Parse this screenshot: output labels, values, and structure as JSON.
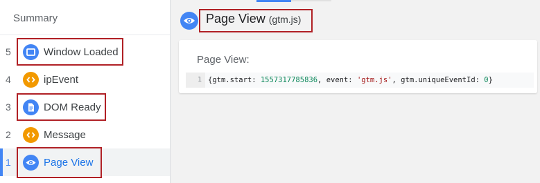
{
  "sidebar": {
    "title": "Summary",
    "events": [
      {
        "number": "5",
        "label": "Window Loaded",
        "icon": "window-icon",
        "icon_color": "#4285f4",
        "highlighted": true,
        "selected": false
      },
      {
        "number": "4",
        "label": "ipEvent",
        "icon": "code-brackets-icon",
        "icon_color": "#f29900",
        "highlighted": false,
        "selected": false
      },
      {
        "number": "3",
        "label": "DOM Ready",
        "icon": "document-icon",
        "icon_color": "#4285f4",
        "highlighted": true,
        "selected": false
      },
      {
        "number": "2",
        "label": "Message",
        "icon": "code-brackets-icon",
        "icon_color": "#f29900",
        "highlighted": false,
        "selected": false
      },
      {
        "number": "1",
        "label": "Page View",
        "icon": "eye-icon",
        "icon_color": "#4285f4",
        "highlighted": true,
        "selected": true
      }
    ]
  },
  "main": {
    "header": {
      "icon": "eye-icon",
      "title": "Page View",
      "tag": "(gtm.js)"
    },
    "card": {
      "title": "Page View:",
      "code": {
        "line_number": "1",
        "open": "{gtm.start: ",
        "start_value": "1557317785836",
        "mid": ", event: ",
        "event_value": "'gtm.js'",
        "mid2": ", gtm.uniqueEventId: ",
        "id_value": "0",
        "close": "}"
      }
    }
  },
  "colors": {
    "accent_blue": "#4285f4",
    "accent_orange": "#f29900",
    "highlight_red": "#b02025"
  }
}
